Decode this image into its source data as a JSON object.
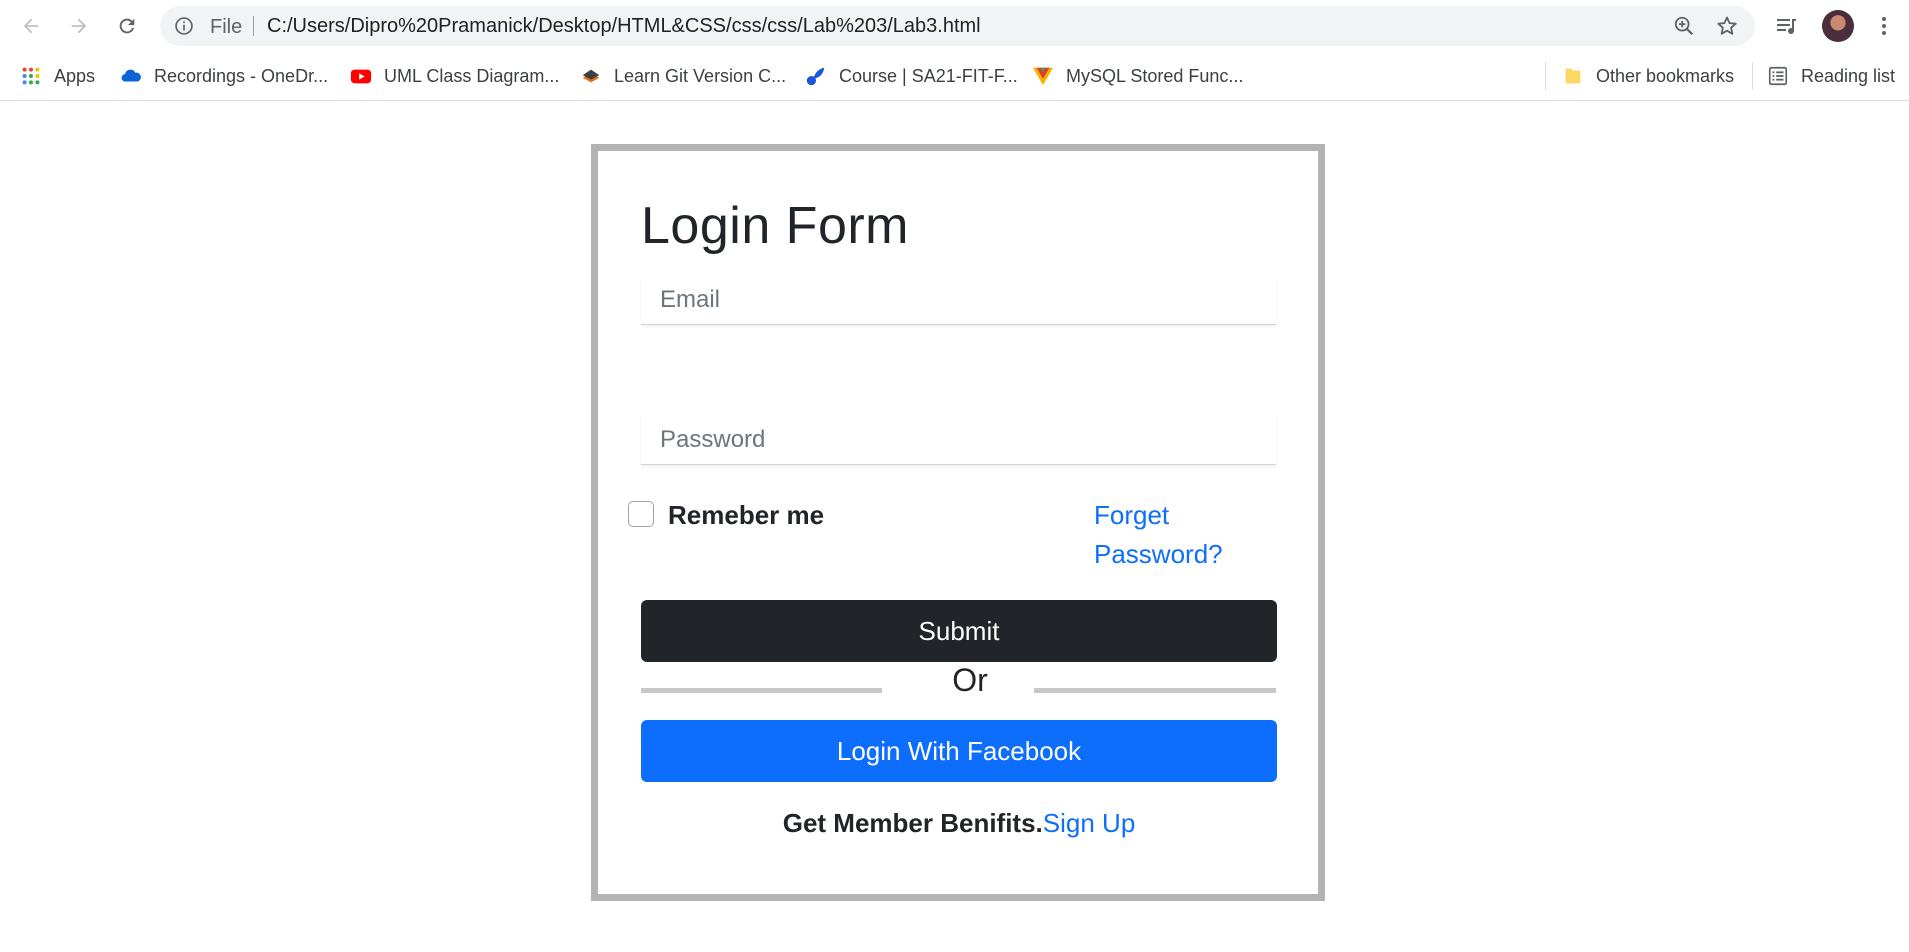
{
  "browser": {
    "address_scheme": "File",
    "url": "C:/Users/Dipro%20Pramanick/Desktop/HTML&CSS/css/css/Lab%203/Lab3.html"
  },
  "bookmarks": {
    "items": [
      {
        "label": "Apps",
        "icon": "apps-grid-icon"
      },
      {
        "label": "Recordings - OneDr...",
        "icon": "onedrive-icon"
      },
      {
        "label": "UML Class Diagram...",
        "icon": "youtube-icon"
      },
      {
        "label": "Learn Git Version C...",
        "icon": "git-course-icon"
      },
      {
        "label": "Course | SA21-FIT-F...",
        "icon": "course-icon"
      },
      {
        "label": "MySQL Stored Func...",
        "icon": "mysql-icon"
      }
    ],
    "other": "Other bookmarks",
    "reading_list": "Reading list"
  },
  "form": {
    "title": "Login Form",
    "email_placeholder": "Email",
    "password_placeholder": "Password",
    "remember_label": "Remeber me",
    "forget_label": "Forget Password?",
    "submit_label": "Submit",
    "or_label": "Or",
    "facebook_label": "Login With Facebook",
    "member_text": "Get Member Benifits.",
    "signup_label": "Sign Up"
  },
  "colors": {
    "primary": "#0d6efd",
    "dark": "#212529",
    "frame_border": "#b3b3b3"
  }
}
